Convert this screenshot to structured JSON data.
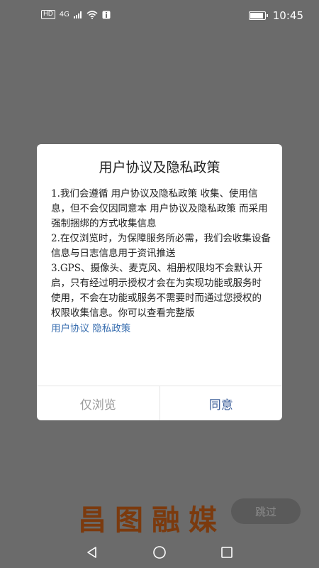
{
  "status_bar": {
    "hd_label": "HD",
    "network_label": "4G",
    "time": "10:45"
  },
  "dialog": {
    "title": "用户协议及隐私政策",
    "paragraphs": [
      "1.我们会遵循 用户协议及隐私政策 收集、使用信息，但不会仅因同意本 用户协议及隐私政策 而采用强制捆绑的方式收集信息",
      "2.在仅浏览时，为保障服务所必需，我们会收集设备信息与日志信息用于资讯推送",
      "3.GPS、摄像头、麦克风、相册权限均不会默认开启，只有经过明示授权才会在为实现功能或服务时使用，不会在功能或服务不需要时而通过您授权的权限收集信息。你可以查看完整版"
    ],
    "link_user_agreement": "用户协议",
    "link_privacy_policy": "隐私政策",
    "browse_only_button": "仅浏览",
    "agree_button": "同意"
  },
  "skip_button": "跳过",
  "brand_logo_text": "昌图融媒",
  "icons": {
    "back": "triangle-back-icon",
    "home": "circle-home-icon",
    "recent": "square-recent-icon"
  }
}
